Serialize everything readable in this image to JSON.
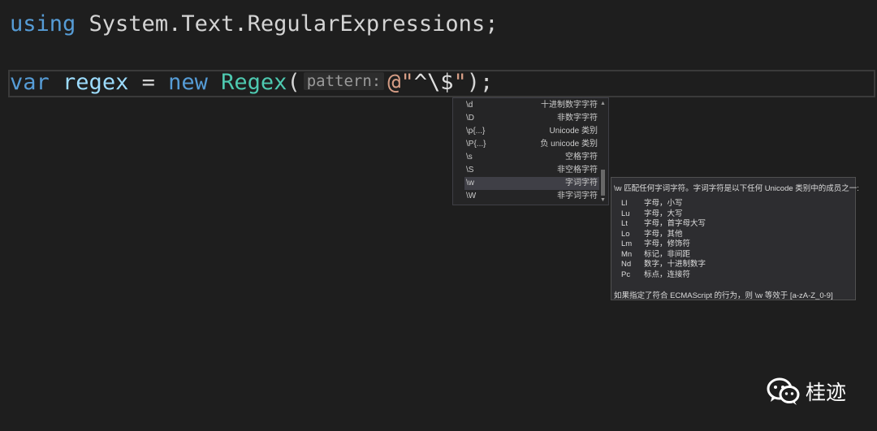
{
  "editor": {
    "line1": {
      "keyword": "using",
      "namespace": " System.Text.RegularExpressions;"
    },
    "line2": {
      "kw_var": "var",
      "var_name": "regex",
      "equals": " = ",
      "kw_new": "new",
      "type_name": "Regex",
      "open_paren": "(",
      "param_hint": "pattern:",
      "str_open": "@\"",
      "str_caret": "^",
      "str_escape": "\\$",
      "str_close": "\"",
      "close": ");"
    }
  },
  "completion_list": {
    "items": [
      {
        "key": "\\d",
        "desc": "十进制数字字符"
      },
      {
        "key": "\\D",
        "desc": "非数字字符"
      },
      {
        "key": "\\p{...}",
        "desc": "Unicode 类别"
      },
      {
        "key": "\\P{...}",
        "desc": "负 unicode 类别"
      },
      {
        "key": "\\s",
        "desc": "空格字符"
      },
      {
        "key": "\\S",
        "desc": "非空格字符"
      },
      {
        "key": "\\w",
        "desc": "字词字符"
      },
      {
        "key": "\\W",
        "desc": "非字词字符"
      }
    ],
    "selected_index": 6
  },
  "tooltip": {
    "header": "\\w 匹配任何字词字符。字词字符是以下任何 Unicode 类别中的成员之一:",
    "categories": [
      {
        "code": "Ll",
        "desc": "字母，小写"
      },
      {
        "code": "Lu",
        "desc": "字母，大写"
      },
      {
        "code": "Lt",
        "desc": "字母，首字母大写"
      },
      {
        "code": "Lo",
        "desc": "字母，其他"
      },
      {
        "code": "Lm",
        "desc": "字母，修饰符"
      },
      {
        "code": "Mn",
        "desc": "标记，非间距"
      },
      {
        "code": "Nd",
        "desc": "数字，十进制数字"
      },
      {
        "code": "Pc",
        "desc": "标点，连接符"
      }
    ],
    "footer": "如果指定了符合 ECMAScript 的行为，则 \\w 等效于 [a-zA-Z_0-9]"
  },
  "watermark": {
    "icon": "wechat-icon",
    "label": "桂迹"
  },
  "colors": {
    "background": "#1e1e1e",
    "keyword": "#569cd6",
    "identifier": "#9cdcfe",
    "type": "#4ec9b0",
    "string": "#d69d85"
  }
}
